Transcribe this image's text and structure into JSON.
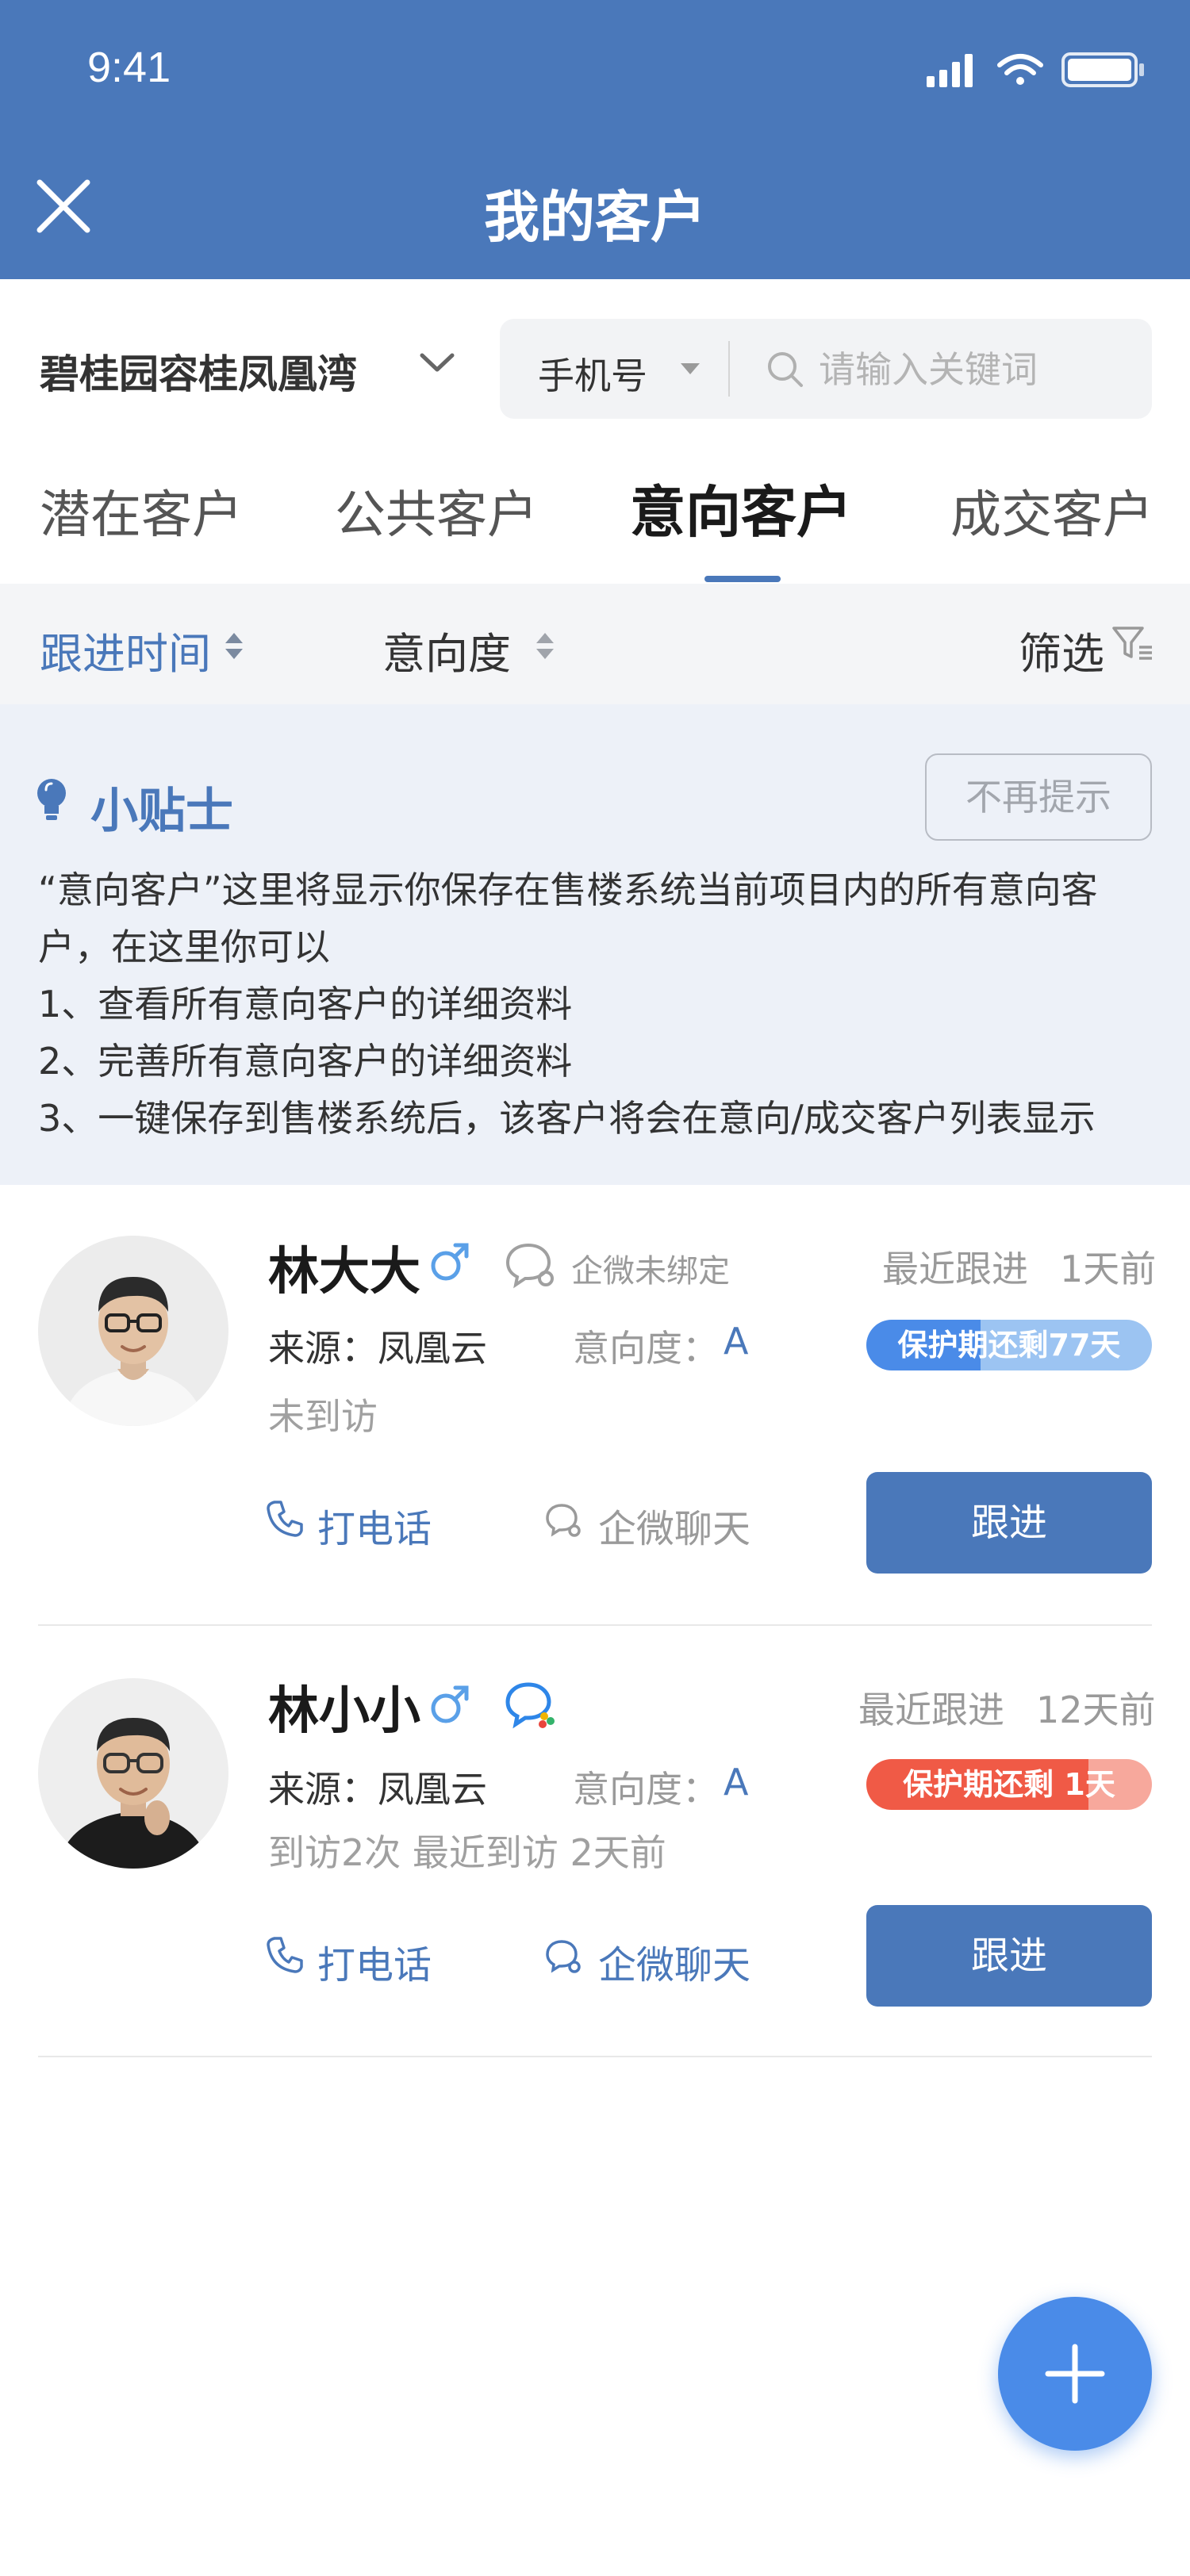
{
  "status_bar": {
    "time": "9:41"
  },
  "header": {
    "title": "我的客户"
  },
  "project": {
    "name": "碧桂园容桂凤凰湾"
  },
  "search": {
    "type": "手机号",
    "placeholder": "请输入关键词"
  },
  "tabs": [
    {
      "label": "潜在客户",
      "active": false
    },
    {
      "label": "公共客户",
      "active": false
    },
    {
      "label": "意向客户",
      "active": true
    },
    {
      "label": "成交客户",
      "active": false
    }
  ],
  "sort": {
    "follow_time": "跟进时间",
    "intent": "意向度",
    "filter": "筛选"
  },
  "tips": {
    "title": "小贴士",
    "dismiss": "不再提示",
    "lines": [
      "“意向客户”这里将显示你保存在售楼系统当前项目内的所有意向客",
      "户，在这里你可以",
      "1、查看所有意向客户的详细资料",
      "2、完善所有意向客户的详细资料",
      "3、一键保存到售楼系统后，该客户将会在意向/成交客户列表显示"
    ]
  },
  "customers": [
    {
      "name": "林大大",
      "gender_icon": "male-icon",
      "wechat_status": "企微未绑定",
      "recent_label": "最近跟进",
      "recent_value": "1天前",
      "source": "来源：凤凰云",
      "intent_label": "意向度：",
      "intent_value": "A",
      "protection": "保护期还剩77天",
      "protection_progress": 0.4,
      "protection_color": "#4a8be8",
      "visit": "未到访",
      "call": "打电话",
      "chat": "企微聊天",
      "follow": "跟进"
    },
    {
      "name": "林小小",
      "gender_icon": "male-icon",
      "wechat_status": "",
      "recent_label": "最近跟进",
      "recent_value": "12天前",
      "source": "来源：凤凰云",
      "intent_label": "意向度：",
      "intent_value": "A",
      "protection": "保护期还剩 1天",
      "protection_progress": 0.78,
      "protection_color": "#f05a46",
      "visit": "到访2次   最近到访 2天前",
      "call": "打电话",
      "chat": "企微聊天",
      "follow": "跟进"
    }
  ],
  "colors": {
    "brand": "#4a78ba",
    "accent": "#4a8be8",
    "warning": "#f05a46"
  },
  "fab": {
    "icon": "plus-icon"
  }
}
